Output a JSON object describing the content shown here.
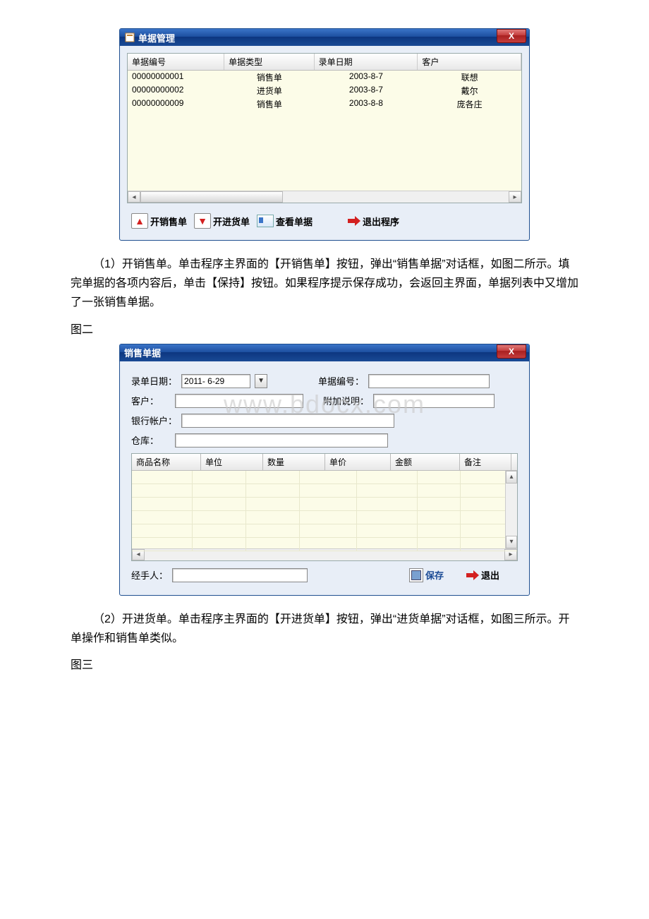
{
  "win1": {
    "title": "单据管理",
    "headers": {
      "c1": "单据编号",
      "c2": "单据类型",
      "c3": "录单日期",
      "c4": "客户"
    },
    "rows": [
      {
        "id": "00000000001",
        "type": "销售单",
        "date": "2003-8-7",
        "cust": "联想"
      },
      {
        "id": "00000000002",
        "type": "进货单",
        "date": "2003-8-7",
        "cust": "戴尔"
      },
      {
        "id": "00000000009",
        "type": "销售单",
        "date": "2003-8-8",
        "cust": "庞各庄"
      }
    ],
    "toolbar": {
      "open_sale": "开销售单",
      "open_purchase": "开进货单",
      "view": "查看单据",
      "exit": "退出程序"
    }
  },
  "para1": "（1）开销售单。单击程序主界面的【开销售单】按钮，弹出“销售单据”对话框，如图二所示。填完单据的各项内容后，单击【保持】按钮。如果程序提示保存成功，会返回主界面，单据列表中又增加了一张销售单据。",
  "caption2": "图二",
  "win2": {
    "title": "销售单据",
    "date_label": "录单日期：",
    "date_value": "2011- 6-29",
    "id_label": "单据编号：",
    "cust_label": "客户：",
    "extra_label": "附加说明：",
    "bank_label": "银行帐户：",
    "store_label": "仓库：",
    "grid_headers": {
      "g1": "商品名称",
      "g2": "单位",
      "g3": "数量",
      "g4": "单价",
      "g5": "金额",
      "g6": "备注"
    },
    "handler_label": "经手人：",
    "save": "保存",
    "exit": "退出"
  },
  "para2": "（2）开进货单。单击程序主界面的【开进货单】按钮，弹出“进货单据”对话框，如图三所示。开单操作和销售单类似。",
  "caption3": "图三",
  "watermark": "www.bdocx.com"
}
